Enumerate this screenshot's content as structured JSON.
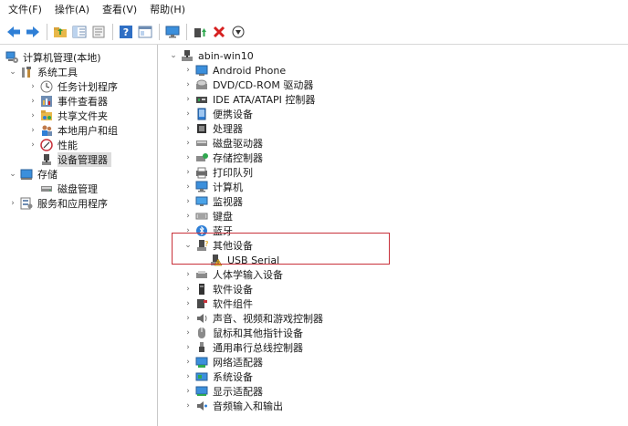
{
  "menu": [
    "文件(F)",
    "操作(A)",
    "查看(V)",
    "帮助(H)"
  ],
  "toolbar": {
    "icons": [
      "back-arrow-icon",
      "forward-arrow-icon",
      "folder-up-icon",
      "console-tree-icon",
      "properties-sheet-icon",
      "help-icon",
      "view-pane-icon",
      "monitor-scan-icon",
      "update-driver-icon",
      "uninstall-x-icon",
      "disable-device-icon"
    ]
  },
  "left_tree": {
    "root": "计算机管理(本地)",
    "system_tools": "系统工具",
    "task_scheduler": "任务计划程序",
    "event_viewer": "事件查看器",
    "shared_folders": "共享文件夹",
    "local_users": "本地用户和组",
    "performance": "性能",
    "device_manager": "设备管理器",
    "storage": "存储",
    "disk_management": "磁盘管理",
    "services_apps": "服务和应用程序"
  },
  "device_tree": {
    "root": "abin-win10",
    "categories": [
      "Android Phone",
      "DVD/CD-ROM 驱动器",
      "IDE ATA/ATAPI 控制器",
      "便携设备",
      "处理器",
      "磁盘驱动器",
      "存储控制器",
      "打印队列",
      "计算机",
      "监视器",
      "键盘",
      "蓝牙",
      "其他设备",
      "人体学输入设备",
      "软件设备",
      "软件组件",
      "声音、视频和游戏控制器",
      "鼠标和其他指针设备",
      "通用串行总线控制器",
      "网络适配器",
      "系统设备",
      "显示适配器",
      "音频输入和输出"
    ],
    "other_child": "USB Serial"
  },
  "colors": {
    "highlight_border": "#c8313a",
    "selection_bg": "#dcdcdc"
  }
}
